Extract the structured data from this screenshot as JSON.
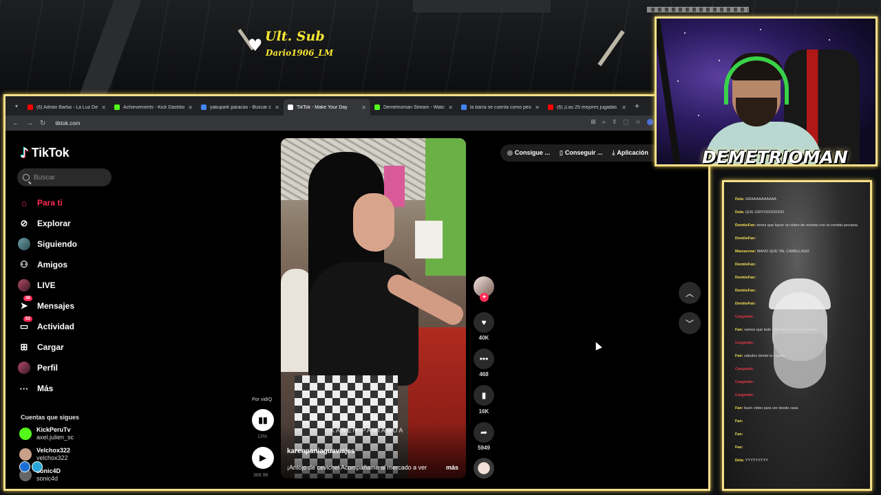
{
  "overlay": {
    "sub_alert": {
      "title": "Ult. Sub",
      "user": "Dario1906_LM"
    },
    "streamer_name": "DEMETRIOMAN"
  },
  "browser": {
    "tabs": [
      {
        "label": "(6) Adrián Barba - La Luz Del Fu",
        "favicon_color": "#ff0000",
        "active": false
      },
      {
        "label": "Achievements - Kick Dashboard",
        "favicon_color": "#53fc18",
        "active": false
      },
      {
        "label": "yakupark paracas - Buscar con",
        "favicon_color": "#4285f4",
        "active": false
      },
      {
        "label": "TikTok - Make Your Day",
        "favicon_color": "#ffffff",
        "active": true
      },
      {
        "label": "Demetrioman Stream - Watch",
        "favicon_color": "#53fc18",
        "active": false
      },
      {
        "label": "la barra se cuenta como peso",
        "favicon_color": "#4285f4",
        "active": false
      },
      {
        "label": "(6) ¡Las 25 mejores jugadas de",
        "favicon_color": "#ff0000",
        "active": false
      }
    ],
    "url": "tiktok.com"
  },
  "tiktok": {
    "logo": "TikTok",
    "search_placeholder": "Buscar",
    "nav": [
      {
        "label": "Para ti",
        "icon": "home-icon",
        "active": true
      },
      {
        "label": "Explorar",
        "icon": "compass-icon"
      },
      {
        "label": "Siguiendo",
        "icon": "avatar"
      },
      {
        "label": "Amigos",
        "icon": "friends-icon"
      },
      {
        "label": "LIVE",
        "icon": "avatar"
      },
      {
        "label": "Mensajes",
        "icon": "send-icon",
        "badge": "38"
      },
      {
        "label": "Actividad",
        "icon": "inbox-icon",
        "badge": "53"
      },
      {
        "label": "Cargar",
        "icon": "upload-icon"
      },
      {
        "label": "Perfil",
        "icon": "avatar"
      },
      {
        "label": "Más",
        "icon": "more-icon"
      }
    ],
    "following_title": "Cuentas que sigues",
    "following": [
      {
        "name": "KickPeruTv",
        "handle": "axel.julien_sc"
      },
      {
        "name": "Velchox322",
        "handle": "velchox322"
      },
      {
        "name": "sonic4D",
        "handle": "sonic4d"
      }
    ],
    "top_actions": [
      "Consigue ...",
      "Conseguir ...",
      "Aplicación"
    ],
    "video": {
      "watermark": "KAREN PANIAGUA",
      "username": "karenpaniaguaviajes",
      "caption": "¡Antojo de cevichel Acompáñame al mercado a ver",
      "more": "más"
    },
    "vidiq": {
      "label": "Por vidIQ",
      "percent": "13%",
      "views": "366.9K"
    },
    "actions": {
      "likes": "40K",
      "comments": "468",
      "saves": "16K",
      "shares": "5949"
    }
  },
  "chat": {
    "messages": [
      {
        "user": "Dela:",
        "text": "GRAAAAAAAAAA"
      },
      {
        "user": "Dela:",
        "text": "QUE GRITOOOOOOO"
      },
      {
        "user": "DemtioFan:",
        "text": "tenes que hacer un video de recetas con la comida peruana"
      },
      {
        "user": "DemtioFan:",
        "text": ""
      },
      {
        "user": "Mareacrew:",
        "text": "MANO QUE TAL CAMELLASO"
      },
      {
        "user": "DemtioFan:",
        "text": ""
      },
      {
        "user": "DemtioFan:",
        "text": ""
      },
      {
        "user": "DemtioFan:",
        "text": ""
      },
      {
        "user": "DemtioFan:",
        "text": ""
      },
      {
        "user": "Cargando:",
        "text": ""
      },
      {
        "user": "Fan:",
        "text": "vamos que todo sale bien hoy en el stream"
      },
      {
        "user": "Cargando:",
        "text": ""
      },
      {
        "user": "Fan:",
        "text": "saludos desde la capital"
      },
      {
        "user": "Cargando:",
        "text": ""
      },
      {
        "user": "Cargando:",
        "text": ""
      },
      {
        "user": "Cargando:",
        "text": ""
      },
      {
        "user": "Fan:",
        "text": "buen video para ver desde casa"
      },
      {
        "user": "Fan:",
        "text": ""
      },
      {
        "user": "Fan:",
        "text": ""
      },
      {
        "user": "Fan:",
        "text": ""
      },
      {
        "user": "Dela:",
        "text": "YYYYYYYYY"
      }
    ]
  }
}
